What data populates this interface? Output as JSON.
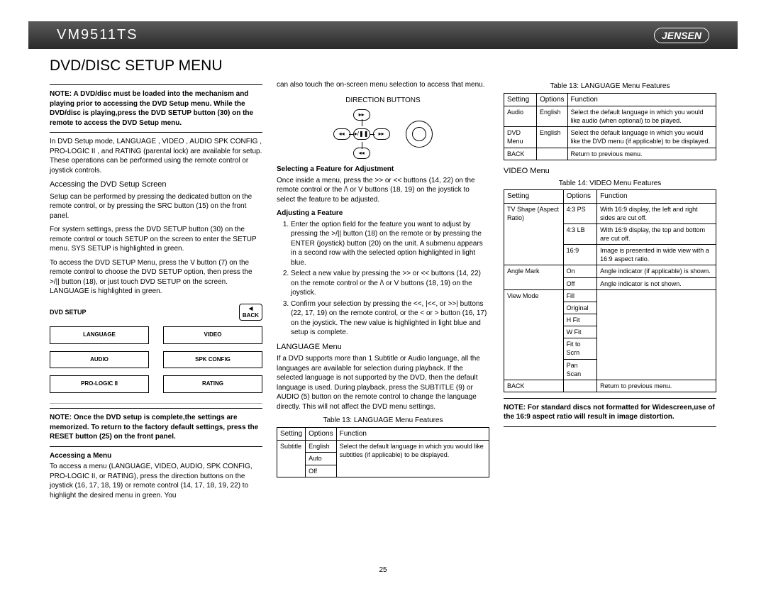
{
  "header": {
    "model": "VM9511TS",
    "brand": "JENSEN"
  },
  "title": "DVD/DISC SETUP MENU",
  "col1": {
    "note1": "NOTE: A DVD/disc must be loaded into the mechanism and playing prior to accessing the DVD Setup menu. While the DVD/disc is playing,press the DVD SETUP button (30) on the remote to access the DVD Setup menu.",
    "intro": "In DVD Setup mode, LANGUAGE , VIDEO , AUDIO SPK CONFIG , PRO-LOGIC II , and RATING (parental lock) are available for setup. These operations can be performed using the remote control or joystick controls.",
    "h_access": "Accessing the DVD Setup Screen",
    "p_access1": "Setup can be performed by pressing the dedicated button on the remote control, or by pressing the SRC button (15) on the front panel.",
    "p_access2": "For system settings, press the DVD SETUP button (30) on the remote control or touch SETUP on the screen to enter the SETUP menu. SYS SETUP is highlighted in green.",
    "p_access3": "To access the DVD SETUP Menu, press the V button (7) on the remote control to choose the DVD SETUP option, then press the >/|| button (18), or just touch DVD SETUP on the screen. LANGUAGE is highlighted in green.",
    "diagram": {
      "title": "DVD SETUP",
      "back": "BACK",
      "buttons": [
        "LANGUAGE",
        "VIDEO",
        "AUDIO",
        "SPK CONFIG",
        "PRO-LOGIC II",
        "RATING"
      ]
    },
    "note2": "NOTE: Once the DVD setup is complete,the settings are memorized. To return to the factory default settings, press the RESET button (25) on the front panel.",
    "h_accmenu": "Accessing a Menu",
    "p_accmenu": "To access a menu (LANGUAGE, VIDEO, AUDIO, SPK CONFIG, PRO-LOGIC II, or RATING), press the direction buttons on the joystick (16, 17, 18, 19) or remote control (14, 17, 18, 19, 22) to highlight the desired menu in green. You"
  },
  "col2": {
    "cont": "can also touch the on-screen menu selection to access that menu.",
    "dir_label": "DIRECTION BUTTONS",
    "h_select": "Selecting a Feature for Adjustment",
    "p_select": "Once inside a menu, press the >> or << buttons (14, 22) on the remote control or the /\\ or V buttons (18, 19) on the joystick to select the feature to be adjusted.",
    "h_adjust": "Adjusting a Feature",
    "li1": "Enter the option field for the feature you want to adjust by pressing the >/|| button (18) on the remote or by pressing the ENTER (joystick) button (20) on the unit. A submenu appears in a second row with the selected option highlighted in light blue.",
    "li2": "Select a new value by pressing the >> or << buttons (14, 22) on the remote control or the /\\ or V buttons (18, 19) on the joystick.",
    "li3": "Confirm your selection by pressing the <<, |<<, or >>| buttons (22, 17, 19) on the remote control, or the < or > button (16, 17) on the joystick. The new value is highlighted in light blue and setup is complete.",
    "h_lang": "LANGUAGE Menu",
    "p_lang": "If a DVD supports more than 1 Subtitle or Audio language, all the languages are available for selection during playback. If the selected language is not supported by the DVD, then the default language is used. During playback, press the SUBTITLE (9) or AUDIO (5) button on the remote control to change the language directly. This will not affect the DVD menu settings.",
    "t13a_caption": "Table 13: LANGUAGE Menu Features",
    "t13a": {
      "headers": [
        "Setting",
        "Options",
        "Function"
      ],
      "rows": [
        [
          "Subtitle",
          "English",
          "Select the default language in which you would like subtitles (if applicable) to be displayed."
        ],
        [
          "",
          "Auto",
          ""
        ],
        [
          "",
          "Off",
          ""
        ]
      ]
    }
  },
  "col3": {
    "t13b_caption": "Table 13: LANGUAGE Menu Features",
    "t13b": {
      "headers": [
        "Setting",
        "Options",
        "Function"
      ],
      "rows": [
        [
          "Audio",
          "English",
          "Select the default language in which you would like audio (when optional) to be played."
        ],
        [
          "DVD Menu",
          "English",
          "Select the default language in which you would like the DVD menu (if applicable) to be displayed."
        ],
        [
          "BACK",
          "",
          "Return to previous menu."
        ]
      ]
    },
    "h_video": "VIDEO Menu",
    "t14_caption": "Table 14: VIDEO Menu Features",
    "t14": {
      "headers": [
        "Setting",
        "Options",
        "Function"
      ],
      "rows": [
        [
          "TV Shape (Aspect Ratio)",
          "4:3 PS",
          "With 16:9 display, the left and right sides are cut off."
        ],
        [
          "",
          "4:3 LB",
          "With 16:9 display, the top and bottom are cut off."
        ],
        [
          "",
          "16:9",
          "Image is presented in wide view with a 16:9 aspect ratio."
        ],
        [
          "Angle Mark",
          "On",
          "Angle indicator (if applicable) is shown."
        ],
        [
          "",
          "Off",
          "Angle indicator is not shown."
        ],
        [
          "View Mode",
          "Fill",
          ""
        ],
        [
          "",
          "Original",
          ""
        ],
        [
          "",
          "H Fit",
          ""
        ],
        [
          "",
          "W Fit",
          ""
        ],
        [
          "",
          "Fit to Scrn",
          ""
        ],
        [
          "",
          "Pan Scan",
          ""
        ],
        [
          "BACK",
          "",
          "Return to previous menu."
        ]
      ]
    },
    "note3": "NOTE: For standard discs not formatted for Widescreen,use of the 16:9 aspect ratio will result in image distortion."
  },
  "page_num": "25"
}
